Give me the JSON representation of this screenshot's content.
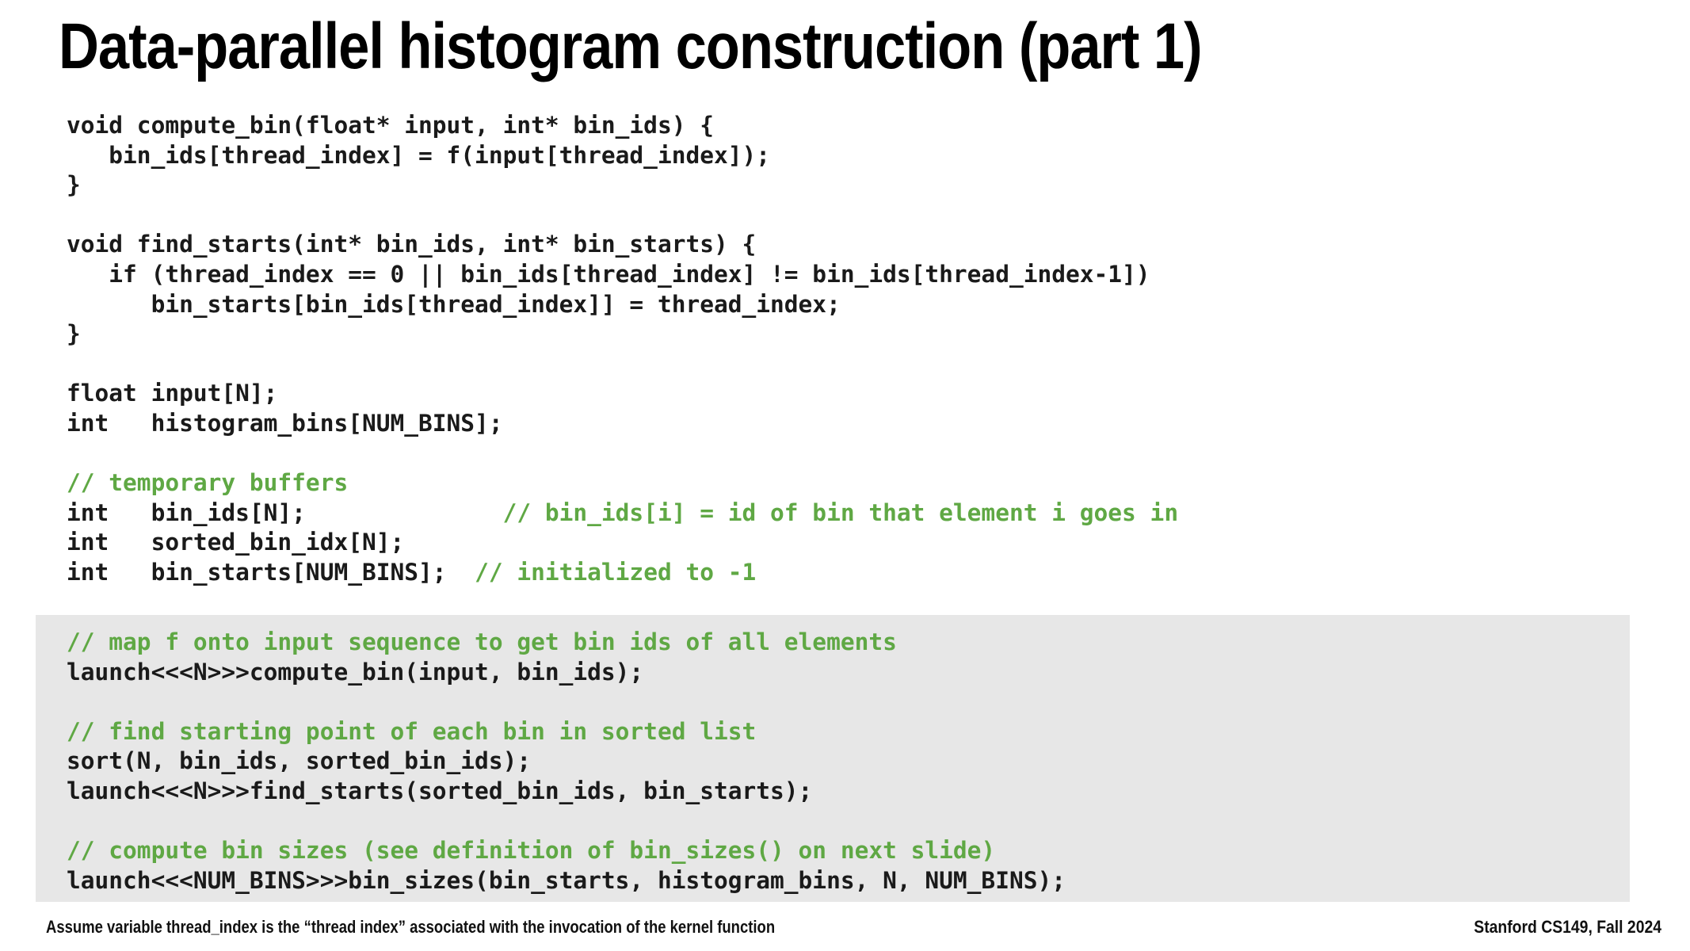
{
  "slide": {
    "title": "Data-parallel histogram construction (part 1)",
    "background_color": "#ffffff",
    "text_color": "#1a1a1a",
    "comment_color": "#5fa844",
    "highlight_background_color": "#e7e7e7"
  },
  "code": {
    "lines": [
      {
        "text": "void compute_bin(float* input, int* bin_ids) {",
        "type": "code"
      },
      {
        "text": "   bin_ids[thread_index] = f(input[thread_index]);",
        "type": "code"
      },
      {
        "text": "}",
        "type": "code"
      },
      {
        "text": "",
        "type": "blank"
      },
      {
        "text": "void find_starts(int* bin_ids, int* bin_starts) {",
        "type": "code"
      },
      {
        "text": "   if (thread_index == 0 || bin_ids[thread_index] != bin_ids[thread_index-1])",
        "type": "code"
      },
      {
        "text": "      bin_starts[bin_ids[thread_index]] = thread_index;",
        "type": "code"
      },
      {
        "text": "}",
        "type": "code"
      },
      {
        "text": "",
        "type": "blank"
      },
      {
        "text": "float input[N];",
        "type": "code"
      },
      {
        "text": "int   histogram_bins[NUM_BINS];",
        "type": "code"
      },
      {
        "text": "",
        "type": "blank"
      },
      {
        "text": "// temporary buffers",
        "type": "comment"
      },
      {
        "code": "int   bin_ids[N];              ",
        "comment": "// bin_ids[i] = id of bin that element i goes in",
        "type": "code+comment"
      },
      {
        "text": "int   sorted_bin_idx[N];",
        "type": "code"
      },
      {
        "code": "int   bin_starts[NUM_BINS];  ",
        "comment": "// initialized to -1",
        "type": "code+comment"
      }
    ]
  },
  "highlighted_code": {
    "lines": [
      {
        "text": "// map f onto input sequence to get bin ids of all elements",
        "type": "comment"
      },
      {
        "text": "launch<<<N>>>compute_bin(input, bin_ids);",
        "type": "code"
      },
      {
        "text": "",
        "type": "blank"
      },
      {
        "text": "// find starting point of each bin in sorted list",
        "type": "comment"
      },
      {
        "text": "sort(N, bin_ids, sorted_bin_ids);",
        "type": "code"
      },
      {
        "text": "launch<<<N>>>find_starts(sorted_bin_ids, bin_starts);",
        "type": "code"
      },
      {
        "text": "",
        "type": "blank"
      },
      {
        "text": "// compute bin sizes (see definition of bin_sizes() on next slide)",
        "type": "comment"
      },
      {
        "text": "launch<<<NUM_BINS>>>bin_sizes(bin_starts, histogram_bins, N, NUM_BINS);",
        "type": "code"
      }
    ]
  },
  "footer": {
    "note": "Assume variable thread_index is the “thread index” associated with the invocation of the kernel function",
    "credit": "Stanford CS149, Fall 2024"
  }
}
